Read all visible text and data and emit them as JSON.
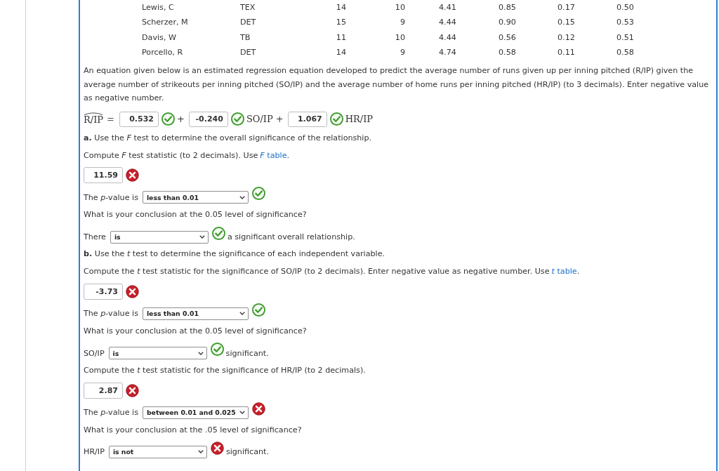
{
  "table": {
    "rows": [
      [
        "Lewis, C",
        "TEX",
        "14",
        "10",
        "4.41",
        "0.85",
        "0.17",
        "0.50"
      ],
      [
        "Scherzer, M",
        "DET",
        "15",
        "9",
        "4.44",
        "0.90",
        "0.15",
        "0.53"
      ],
      [
        "Davis, W",
        "TB",
        "11",
        "10",
        "4.44",
        "0.56",
        "0.12",
        "0.51"
      ],
      [
        "Porcello, R",
        "DET",
        "14",
        "9",
        "4.74",
        "0.58",
        "0.11",
        "0.58"
      ]
    ]
  },
  "intro": "An equation given below is an estimated regression equation developed to predict the average number of runs given up per inning pitched (R/IP) given the average number of strikeouts per inning pitched (SO/IP) and the average number of home runs per inning pitched (HR/IP) (to 3 decimals). Enter negative value as negative number.",
  "equation": {
    "lhs": "R/IP",
    "relation": "=",
    "terms": [
      {
        "value": "0.532",
        "correct": true,
        "after": "+"
      },
      {
        "value": "-0.240",
        "correct": true,
        "after": "SO/IP +"
      },
      {
        "value": "1.067",
        "correct": true,
        "after": "HR/IP"
      }
    ]
  },
  "questions": [
    {
      "kind": "text",
      "text": "**a.** Use the *F* test to determine the overall significance of the relationship."
    },
    {
      "kind": "text",
      "text": "Compute *F* test statistic (to 2 decimals). Use ",
      "link": "*F* table",
      "after": "."
    },
    {
      "kind": "number",
      "value": "11.59",
      "correct": false
    },
    {
      "kind": "choice",
      "label": "The *p*-value is",
      "value": "less than 0.01",
      "correct": true
    },
    {
      "kind": "text",
      "text": "What is your conclusion at the 0.05 level of significance?"
    },
    {
      "kind": "choice",
      "label": "There",
      "value": "is",
      "correct": true,
      "after": "a significant overall relationship."
    },
    {
      "kind": "text",
      "text": "**b.** Use the *t* test to determine the significance of each independent variable."
    },
    {
      "kind": "text",
      "text": "Compute the *t* test statistic for the significance of SO/IP (to 2 decimals). Enter negative value as negative number. Use ",
      "link": "*t* table",
      "after": "."
    },
    {
      "kind": "number",
      "value": "-3.73",
      "correct": false
    },
    {
      "kind": "choice",
      "label": "The *p*-value is",
      "value": "less than 0.01",
      "correct": true
    },
    {
      "kind": "text",
      "text": "What is your conclusion at the 0.05 level of significance?"
    },
    {
      "kind": "choice",
      "label": "SO/IP",
      "value": "is",
      "correct": true,
      "after": "significant."
    },
    {
      "kind": "text",
      "text": "Compute the *t* test statistic for the significance of HR/IP (to 2 decimals)."
    },
    {
      "kind": "number",
      "value": "2.87",
      "correct": false
    },
    {
      "kind": "choice",
      "label": "The *p*-value is",
      "value": "between 0.01 and 0.025",
      "correct": false
    },
    {
      "kind": "text",
      "text": "What is your conclusion at the .05 level of significance?"
    },
    {
      "kind": "choice",
      "label": "HR/IP",
      "value": "is not",
      "correct": false,
      "after": "significant."
    }
  ]
}
